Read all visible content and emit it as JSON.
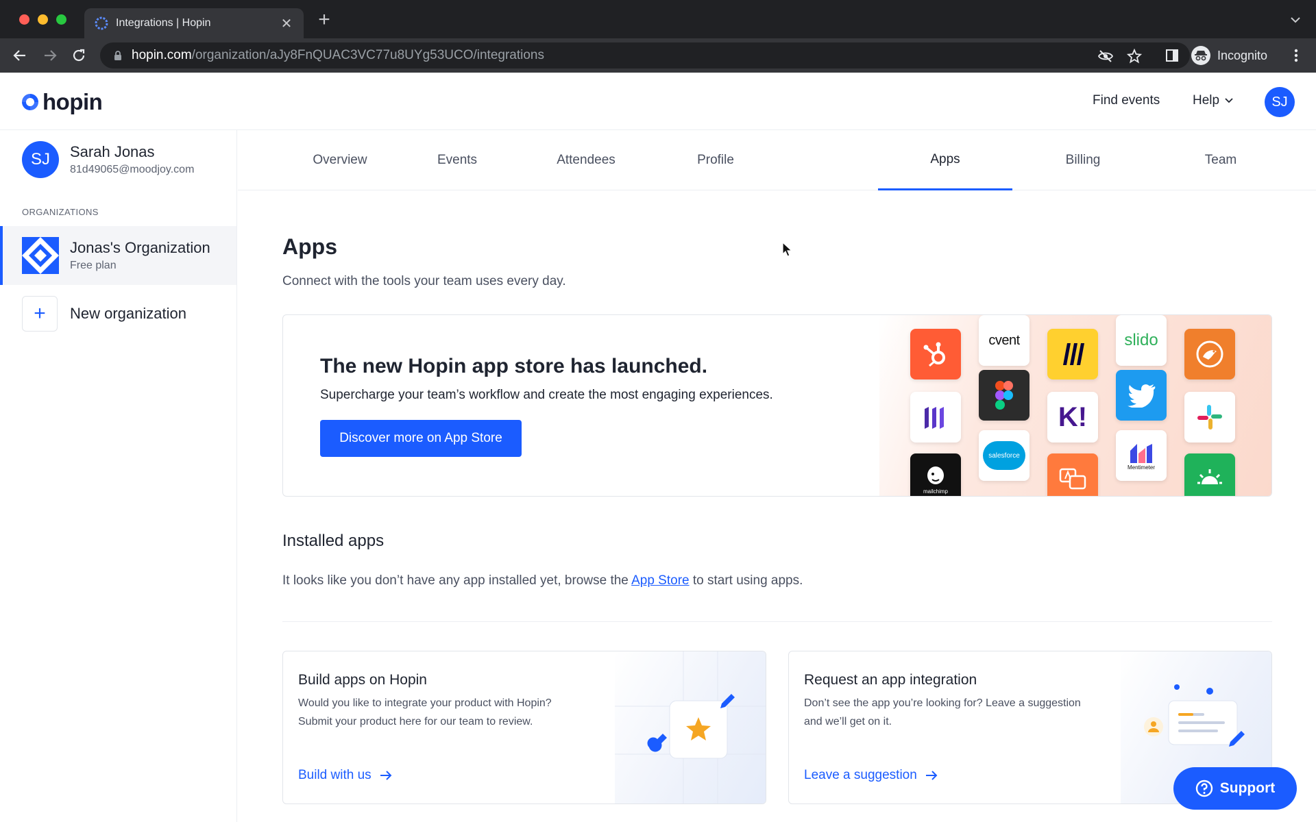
{
  "browser": {
    "tab_title": "Integrations | Hopin",
    "url_host": "hopin.com",
    "url_path": "/organization/aJy8FnQUAC3VC77u8UYg53UCO/integrations",
    "profile_label": "Incognito"
  },
  "header": {
    "logo_text": "hopin",
    "find_events": "Find events",
    "help": "Help",
    "avatar_initials": "SJ"
  },
  "sidebar": {
    "user": {
      "initials": "SJ",
      "name": "Sarah Jonas",
      "email": "81d49065@moodjoy.com"
    },
    "org_heading": "ORGANIZATIONS",
    "org": {
      "name": "Jonas's Organization",
      "plan": "Free plan"
    },
    "new_org_label": "New organization"
  },
  "tabs": [
    {
      "label": "Overview",
      "active": false
    },
    {
      "label": "Events",
      "active": false
    },
    {
      "label": "Attendees",
      "active": false
    },
    {
      "label": "Profile",
      "active": false
    },
    {
      "label": "Apps",
      "active": true
    },
    {
      "label": "Billing",
      "active": false
    },
    {
      "label": "Team",
      "active": false
    }
  ],
  "page": {
    "title": "Apps",
    "subtitle": "Connect with the tools your team uses every day."
  },
  "banner": {
    "title": "The new Hopin app store has launched.",
    "subtitle": "Supercharge your team’s workflow and create the most engaging experiences.",
    "button": "Discover more on App Store",
    "tiles": {
      "cvent": "cvent",
      "slido": "slido",
      "salesforce": "salesforce",
      "mentimeter": "Mentimeter",
      "mailchimp": "mailchimp",
      "kahoot": "K!"
    }
  },
  "installed": {
    "title": "Installed apps",
    "text_before": "It looks like you don’t have any app installed yet, browse the ",
    "link": "App Store",
    "text_after": " to start using apps."
  },
  "cards": {
    "build": {
      "title": "Build apps on Hopin",
      "line1": "Would you like to integrate your product with Hopin?",
      "line2": "Submit your product here for our team to review.",
      "link": "Build with us"
    },
    "request": {
      "title": "Request an app integration",
      "line1": "Don’t see the app you’re looking for? Leave a suggestion",
      "line2": "and we’ll get on it.",
      "link": "Leave a suggestion"
    }
  },
  "support_label": "Support",
  "colors": {
    "brand": "#1b5cff",
    "chrome_dark": "#202124",
    "chrome_mid": "#35363a"
  }
}
